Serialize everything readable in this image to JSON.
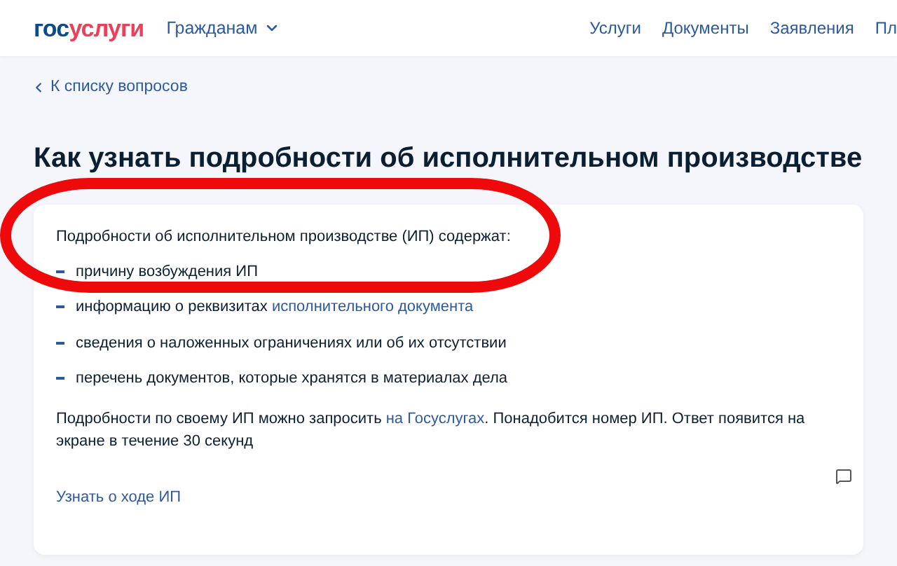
{
  "header": {
    "logo": {
      "part_1": "гос",
      "part_2": "услуги"
    },
    "audience_menu": "Гражданам",
    "nav": [
      "Услуги",
      "Документы",
      "Заявления",
      "Пл"
    ]
  },
  "back_link": "К списку вопросов",
  "title": "Как узнать подробности об исполнительном производстве",
  "card": {
    "intro": "Подробности об исполнительном производстве (ИП) содержат:",
    "items": [
      {
        "text": "причину возбуждения ИП"
      },
      {
        "text": "информацию о реквизитах ",
        "link": "исполнительного документа"
      },
      {
        "text": "сведения о наложенных ограничениях или об их отсутствии"
      },
      {
        "text": "перечень документов, которые хранятся в материалах дела"
      }
    ],
    "paragraph": {
      "before": "Подробности по своему ИП можно запросить ",
      "link": "на Госуслугах",
      "after": ". Понадобится номер ИП. Ответ появится на экране в течение 30 секунд"
    },
    "action_link": "Узнать о ходе ИП"
  }
}
